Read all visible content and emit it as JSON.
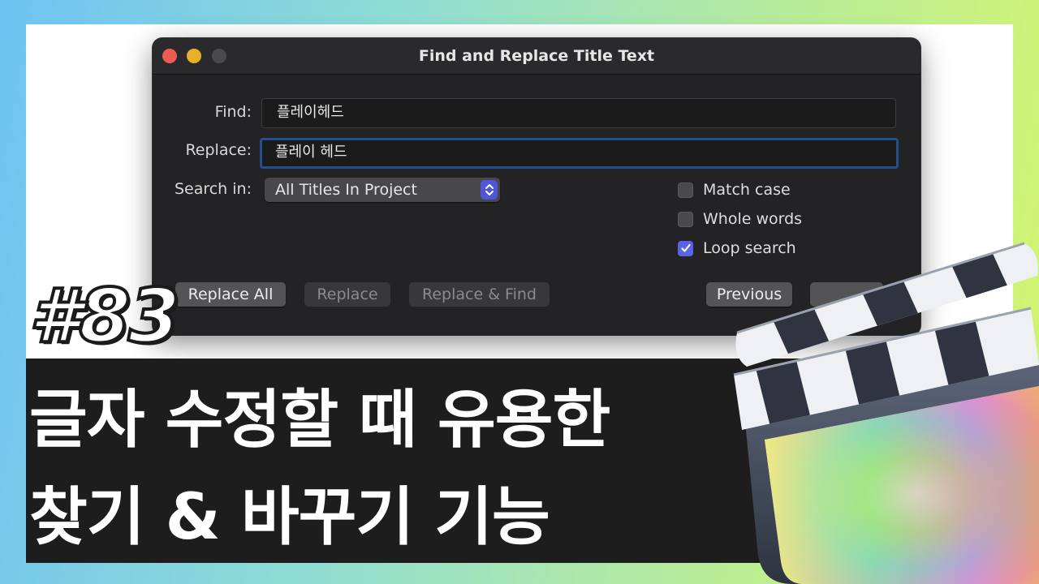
{
  "dialog": {
    "title": "Find and Replace Title Text",
    "find": {
      "label": "Find:",
      "value": "플레이헤드"
    },
    "replace": {
      "label": "Replace:",
      "value": "플레이 헤드"
    },
    "search_in": {
      "label": "Search in:",
      "value": "All Titles In Project"
    },
    "options": [
      {
        "label": "Match case",
        "checked": false
      },
      {
        "label": "Whole words",
        "checked": false
      },
      {
        "label": "Loop search",
        "checked": true
      }
    ],
    "buttons": {
      "replace_all": "Replace All",
      "replace": "Replace",
      "replace_find": "Replace & Find",
      "previous": "Previous"
    }
  },
  "overlay": {
    "episode": "#83",
    "headline_line1": "글자 수정할 때 유용한",
    "headline_line2": "찾기 & 바꾸기 기능"
  },
  "app_icon": "final-cut-pro-clapperboard-icon",
  "colors": {
    "accent_blue": "#5a63e6",
    "close": "#ee5b52",
    "minimize": "#e8b027",
    "dialog_bg": "#232325"
  }
}
